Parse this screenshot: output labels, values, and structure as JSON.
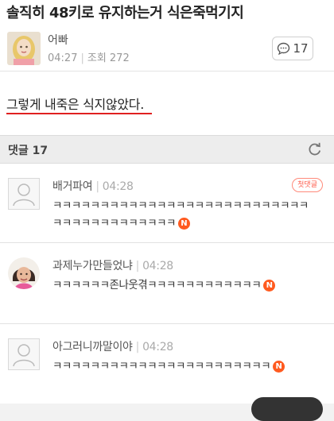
{
  "post": {
    "title": "솔직히 48키로 유지하는거 식은죽먹기지",
    "author": "어빠",
    "time": "04:27",
    "views_label": "조회 272",
    "comment_count": "17",
    "body": "그렇게 내죽은 식지않았다."
  },
  "comments_section": {
    "title": "댓글 17"
  },
  "comments": [
    {
      "author": "배거파여",
      "time": "04:28",
      "badge": "첫댓글",
      "text": "ㅋㅋㅋㅋㅋㅋㅋㅋㅋㅋㅋㅋㅋㅋㅋㅋㅋㅋㅋㅋㅋㅋㅋㅋㅋㅋㅋㅋㅋㅋㅋㅋㅋㅋㅋㅋㅋㅋㅋㅋ",
      "new_mark": "N"
    },
    {
      "author": "과제누가만들었냐",
      "time": "04:28",
      "text": "ㅋㅋㅋㅋㅋㅋ존나웃겪ㅋㅋㅋㅋㅋㅋㅋㅋㅋㅋㅋㅋ",
      "new_mark": "N"
    },
    {
      "author": "아그러니까말이야",
      "time": "04:28",
      "text": "ㅋㅋㅋㅋㅋㅋㅋㅋㅋㅋㅋㅋㅋㅋㅋㅋㅋㅋㅋㅋㅋㅋㅋ",
      "new_mark": "N"
    }
  ],
  "icons": {
    "comment_bubble": "speech-bubble-icon",
    "refresh": "refresh-icon",
    "default_avatar": "person-silhouette-icon"
  },
  "colors": {
    "accent_red": "#e02020",
    "new_badge": "#ff5a1f"
  }
}
